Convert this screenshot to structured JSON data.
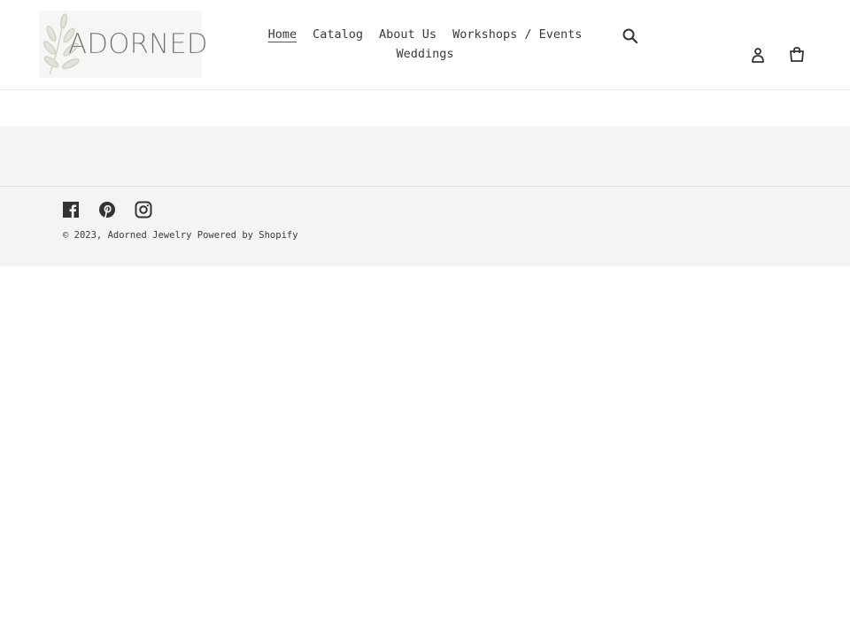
{
  "header": {
    "logo_text": "ADORNED",
    "logo_alt": "Adorned Jewelry logo",
    "nav": [
      {
        "label": "Home",
        "active": true
      },
      {
        "label": "Catalog",
        "active": false
      },
      {
        "label": "About Us",
        "active": false
      },
      {
        "label": "Workshops / Events",
        "active": false
      },
      {
        "label": "Weddings",
        "active": false
      }
    ],
    "icons": {
      "search": "search-icon",
      "login": "user-icon",
      "cart": "cart-icon"
    }
  },
  "footer": {
    "social": [
      {
        "name": "Facebook",
        "icon": "facebook-icon"
      },
      {
        "name": "Pinterest",
        "icon": "pinterest-icon"
      },
      {
        "name": "Instagram",
        "icon": "instagram-icon"
      }
    ],
    "copyright_prefix": "© 2023,",
    "store_name": "Adorned Jewelry",
    "powered_by": "Powered by Shopify"
  },
  "colors": {
    "text": "#3a3a3a",
    "footer_bg": "#f4f4f4",
    "border": "#e8e8e8"
  }
}
